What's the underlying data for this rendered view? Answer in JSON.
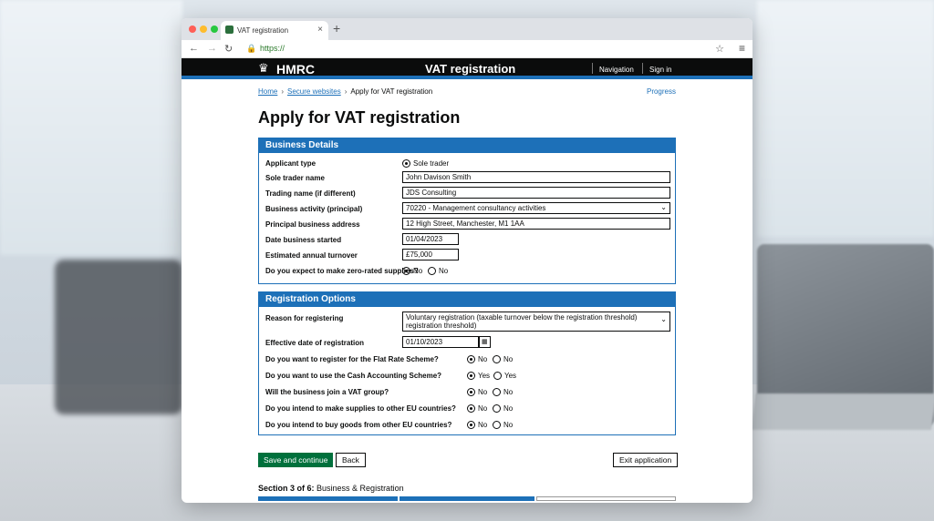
{
  "browser": {
    "tab_title": "VAT registration",
    "tab_close": "×",
    "new_tab": "+",
    "url": "https://",
    "icons": [
      "back-icon",
      "forward-icon",
      "reload-icon",
      "lock-icon",
      "star-icon",
      "menu-icon"
    ]
  },
  "header": {
    "brand": "HMRC",
    "service": "VAT registration",
    "nav_label": "Navigation",
    "signin_label": "Sign in"
  },
  "breadcrumbs": {
    "home": "Home",
    "secure": "Secure websites",
    "current": "Apply for VAT registration",
    "progress_link": "Progress"
  },
  "page_title": "Apply for VAT registration",
  "business": {
    "title": "Business Details",
    "applicant_type_label": "Applicant type",
    "applicant_type_value": "Sole trader",
    "sole_trader_name_label": "Sole trader name",
    "sole_trader_name_value": "John Davison Smith",
    "trading_name_label": "Trading name (if different)",
    "trading_name_value": "JDS Consulting",
    "activity_label": "Business activity (principal)",
    "activity_value": "70220 - Management consultancy activities",
    "address_label": "Principal business address",
    "address_value": "12 High Street, Manchester, M1 1AA",
    "date_started_label": "Date business started",
    "date_started_value": "01/04/2023",
    "turnover_label": "Estimated annual turnover",
    "turnover_value": "£75,000",
    "zero_rated_label": "Do you expect to make zero-rated supplies?",
    "zero_rated_opt1": "No",
    "zero_rated_opt2": "No"
  },
  "registration": {
    "title": "Registration Options",
    "reason_label": "Reason for registering",
    "reason_value": "Voluntary registration (taxable turnover below the registration threshold)",
    "reason_value_line2": "registration threshold)",
    "effective_label": "Effective date of registration",
    "effective_value": "01/10/2023",
    "questions": [
      {
        "label": "Do you want to register for the Flat Rate Scheme?",
        "opt1": "No",
        "opt2": "No"
      },
      {
        "label": "Do you want to use the Cash Accounting Scheme?",
        "opt1": "Yes",
        "opt2": "Yes"
      },
      {
        "label": "Will the business join a VAT group?",
        "opt1": "No",
        "opt2": "No"
      },
      {
        "label": "Do you intend to make supplies to other EU countries?",
        "opt1": "No",
        "opt2": "No"
      },
      {
        "label": "Do you intend to buy goods from other EU countries?",
        "opt1": "No",
        "opt2": "No"
      }
    ]
  },
  "actions": {
    "save_continue": "Save and continue",
    "back": "Back",
    "exit": "Exit application"
  },
  "section": {
    "label": "Section 3 of 6:",
    "name": "Business & Registration"
  },
  "colors": {
    "primary_blue": "#1d70b8",
    "header_black": "#0b0c0c",
    "button_green": "#00703c"
  }
}
